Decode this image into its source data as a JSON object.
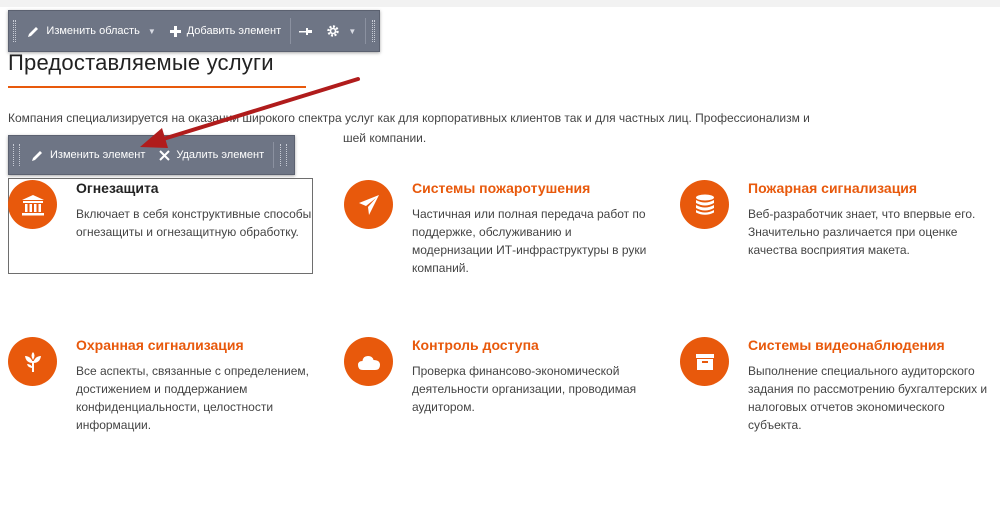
{
  "toolbar_area": {
    "edit_area": "Изменить область",
    "add_element": "Добавить элемент",
    "icons": [
      "pencil-icon",
      "plus-icon",
      "pin-icon",
      "gear-icon",
      "grip-icon"
    ]
  },
  "toolbar_element": {
    "edit_element": "Изменить элемент",
    "delete_element": "Удалить элемент"
  },
  "section": {
    "title": "Предоставляемые услуги",
    "intro_line1": "Компания специализируется на оказании широкого спектра услуг как для корпоративных клиентов так и для частных лиц. Профессионализм и",
    "intro_line2": "шей компании."
  },
  "services": [
    {
      "title": "Огнезащита",
      "text": "Включает в себя конструктивные способы огнезащиты и огнезащитную обработку.",
      "icon": "bank-icon"
    },
    {
      "title": "Системы пожаротушения",
      "text": "Частичная или полная передача работ по поддержке, обслуживанию и модернизации ИТ-инфраструктуры в руки компаний.",
      "icon": "paper-plane-icon"
    },
    {
      "title": "Пожарная сигнализация",
      "text": "Веб-разработчик знает, что впервые его. Значительно различается при оценке качества восприятия макета.",
      "icon": "database-icon"
    },
    {
      "title": "Охранная сигнализация",
      "text": "Все аспекты, связанные с определением, достижением и поддержанием конфиденциальности, целостности информации.",
      "icon": "leaf-icon"
    },
    {
      "title": "Контроль доступа",
      "text": "Проверка финансово-экономической деятельности организации, проводимая аудитором.",
      "icon": "cloud-icon"
    },
    {
      "title": "Системы видеонаблюдения",
      "text": "Выполнение специального аудиторского задания по рассмотрению бухгалтерских и налоговых отчетов экономического субъекта.",
      "icon": "archive-icon"
    }
  ],
  "colors": {
    "accent": "#e8590c",
    "toolbar": "#6e7585",
    "arrow": "#b01c1c"
  }
}
